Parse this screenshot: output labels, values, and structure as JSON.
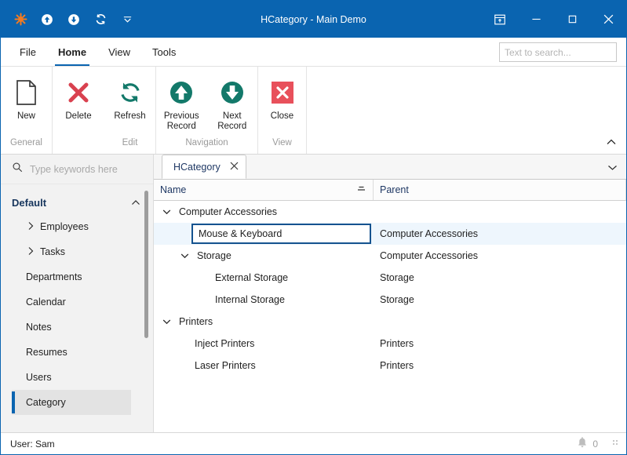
{
  "window": {
    "title": "HCategory - Main Demo",
    "quick_access": [
      {
        "name": "settings-icon",
        "label": "Settings"
      },
      {
        "name": "upload-icon",
        "label": "Upload"
      },
      {
        "name": "download-icon",
        "label": "Download"
      },
      {
        "name": "refresh-icon",
        "label": "Refresh"
      },
      {
        "name": "chevron-down-icon",
        "label": "Customize Quick Access Toolbar"
      }
    ],
    "controls": {
      "ribbon_display_options": "Ribbon Display Options",
      "minimize": "Minimize",
      "maximize": "Maximize",
      "close": "Close"
    },
    "colors": {
      "titlebar": "#0a64b0",
      "accent": "#0a64b0",
      "icon_orange": "#f07d00",
      "icon_teal": "#13796a",
      "icon_red": "#e8505b",
      "selection_row": "#eef6fd",
      "edit_border": "#15538f"
    }
  },
  "ribbon": {
    "tabs": [
      {
        "label": "File",
        "active": false
      },
      {
        "label": "Home",
        "active": true
      },
      {
        "label": "View",
        "active": false
      },
      {
        "label": "Tools",
        "active": false
      }
    ],
    "search": {
      "placeholder": "Text to search...",
      "value": "",
      "icon": "search-icon"
    },
    "collapse_icon": "chevron-up-icon",
    "groups": [
      {
        "label": "General",
        "buttons": [
          {
            "label": "New",
            "icon": "new-document-icon"
          }
        ]
      },
      {
        "label": "Edit",
        "buttons": [
          {
            "label": "Delete",
            "icon": "delete-x-icon"
          }
        ]
      },
      {
        "label": "Edit",
        "label_hidden": true,
        "buttons": [
          {
            "label": "Refresh",
            "icon": "refresh-icon"
          }
        ]
      },
      {
        "label": "Navigation",
        "buttons": [
          {
            "label": "Previous\nRecord",
            "label_line1": "Previous",
            "label_line2": "Record",
            "icon": "arrow-up-circle-icon"
          },
          {
            "label": "Next\nRecord",
            "label_line1": "Next",
            "label_line2": "Record",
            "icon": "arrow-down-circle-icon"
          }
        ]
      },
      {
        "label": "View",
        "buttons": [
          {
            "label": "Close",
            "icon": "close-square-icon"
          }
        ]
      }
    ],
    "group_labels": {
      "general": "General",
      "edit": "Edit",
      "navigation": "Navigation",
      "view": "View"
    },
    "buttons": {
      "new": "New",
      "delete": "Delete",
      "refresh": "Refresh",
      "prev_l1": "Previous",
      "prev_l2": "Record",
      "next_l1": "Next",
      "next_l2": "Record",
      "close": "Close"
    }
  },
  "sidebar": {
    "search": {
      "placeholder": "Type keywords here",
      "value": "",
      "icon": "search-icon"
    },
    "section": {
      "label": "Default",
      "collapse_icon": "chevron-up-icon"
    },
    "items": [
      {
        "label": "Employees",
        "expandable": true,
        "selected": false
      },
      {
        "label": "Tasks",
        "expandable": true,
        "selected": false
      },
      {
        "label": "Departments",
        "expandable": false,
        "selected": false
      },
      {
        "label": "Calendar",
        "expandable": false,
        "selected": false
      },
      {
        "label": "Notes",
        "expandable": false,
        "selected": false
      },
      {
        "label": "Resumes",
        "expandable": false,
        "selected": false
      },
      {
        "label": "Users",
        "expandable": false,
        "selected": false
      },
      {
        "label": "Category",
        "expandable": false,
        "selected": true
      }
    ]
  },
  "document": {
    "tab": {
      "label": "HCategory",
      "close_icon": "close-icon"
    },
    "tabstrip_chevron": "chevron-down-icon"
  },
  "grid": {
    "columns": [
      {
        "label": "Name",
        "filter_icon": "filter-icon"
      },
      {
        "label": "Parent",
        "filter_icon": ""
      }
    ],
    "rows": [
      {
        "name": "Computer Accessories",
        "parent": "",
        "indent": 0,
        "twisty": "expanded",
        "selected": false,
        "editing": false
      },
      {
        "name": "Mouse & Keyboard",
        "parent": "Computer Accessories",
        "indent": 1,
        "twisty": "none",
        "selected": true,
        "editing": true
      },
      {
        "name": "Storage",
        "parent": "Computer Accessories",
        "indent": 1,
        "twisty": "expanded",
        "selected": false,
        "editing": false
      },
      {
        "name": "External Storage",
        "parent": "Storage",
        "indent": 2,
        "twisty": "none",
        "selected": false,
        "editing": false
      },
      {
        "name": "Internal Storage",
        "parent": "Storage",
        "indent": 2,
        "twisty": "none",
        "selected": false,
        "editing": false
      },
      {
        "name": "Printers",
        "parent": "",
        "indent": 0,
        "twisty": "expanded",
        "selected": false,
        "editing": false
      },
      {
        "name": "Inject Printers",
        "parent": "Printers",
        "indent": 1,
        "twisty": "none",
        "selected": false,
        "editing": false
      },
      {
        "name": "Laser Printers",
        "parent": "Printers",
        "indent": 1,
        "twisty": "none",
        "selected": false,
        "editing": false
      }
    ]
  },
  "status": {
    "user_text": "User: Sam",
    "notification_icon": "bell-icon",
    "notification_count": "0",
    "resize_grip": "resize-grip-icon"
  }
}
